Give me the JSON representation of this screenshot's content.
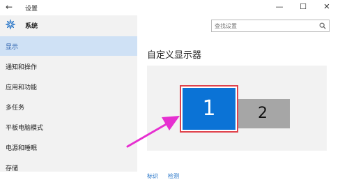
{
  "window": {
    "back_glyph": "←",
    "title": "设置",
    "minimize_glyph": "—",
    "maximize_glyph": "☐",
    "close_glyph": "✕"
  },
  "sidebar": {
    "header_label": "系统",
    "items": [
      {
        "label": "显示",
        "selected": true
      },
      {
        "label": "通知和操作",
        "selected": false
      },
      {
        "label": "应用和功能",
        "selected": false
      },
      {
        "label": "多任务",
        "selected": false
      },
      {
        "label": "平板电脑模式",
        "selected": false
      },
      {
        "label": "电源和睡眠",
        "selected": false
      },
      {
        "label": "存储",
        "selected": false
      }
    ]
  },
  "search": {
    "placeholder": "查找设置"
  },
  "main": {
    "title": "自定义显示器",
    "monitors": [
      {
        "number": "1",
        "selected": true
      },
      {
        "number": "2",
        "selected": false
      }
    ],
    "identify_link": "标识",
    "detect_link": "检测"
  },
  "colors": {
    "accent": "#0b73d6",
    "selection_outline": "#e0424b",
    "annotation_arrow": "#e62fd0",
    "sidebar_selected_bg": "#cfe1f5"
  }
}
